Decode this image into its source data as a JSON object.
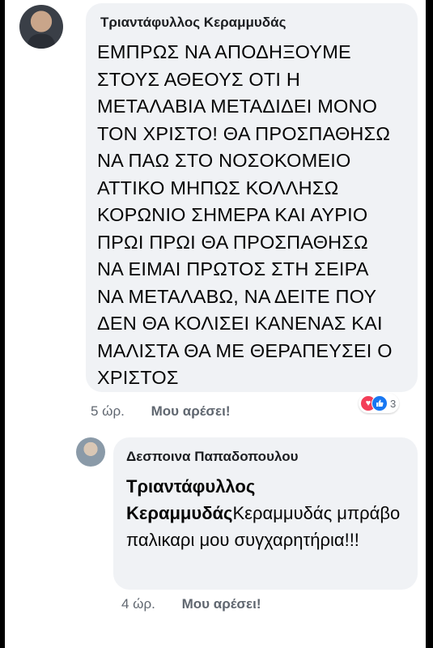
{
  "comment": {
    "author": "Τριαντάφυλλος Κεραμμυδάς",
    "text": "ΕΜΠΡΩΣ ΝΑ ΑΠΟΔΗΞΟΥΜΕ\nΣΤΟΥΣ ΑΘΕΟΥΣ ΟΤΙ Η\nΜΕΤΑΛΑΒΙΑ ΜΕΤΑΔΙΔΕΙ ΜΟΝΟ\nΤΟΝ ΧΡΙΣΤΟ! ΘΑ ΠΡΟΣΠΑΘΗΣΩ\nΝΑ ΠΑΩ ΣΤΟ ΝΟΣΟΚΟΜΕΙΟ\nΑΤΤΙΚΟ ΜΗΠΩΣ ΚΟΛΛΗΣΩ\nΚΟΡΩΝΙΟ ΣΗΜΕΡΑ ΚΑΙ ΑΥΡΙΟ\nΠΡΩΙ ΠΡΩΙ ΘΑ ΠΡΟΣΠΑΘΗΣΩ\nΝΑ ΕΙΜΑΙ ΠΡΩΤΟΣ ΣΤΗ ΣΕΙΡΑ\nΝΑ ΜΕΤΑΛΑΒΩ, ΝΑ ΔΕΙΤΕ ΠΟΥ\nΔΕΝ ΘΑ ΚΟΛΙΣΕΙ ΚΑΝΕΝΑΣ ΚΑΙ\nΜΑΛΙΣΤΑ ΘΑ ΜΕ ΘΕΡΑΠΕΥΣΕΙ Ο\nΧΡΙΣΤΟΣ",
    "time": "5 ώρ.",
    "like_label": "Μου αρέσει!",
    "reactions": {
      "count": "3",
      "icons": [
        "love-icon",
        "like-icon"
      ]
    }
  },
  "reply": {
    "author": "Δεσποινα Παπαδοπουλου",
    "mention": "Τριαντάφυλλος Κεραμμυδάς",
    "text": "Κεραμμυδάς μπράβο παλικαρι μου συγχαρητήρια!!!",
    "time": "4 ώρ.",
    "like_label": "Μου αρέσει!"
  }
}
